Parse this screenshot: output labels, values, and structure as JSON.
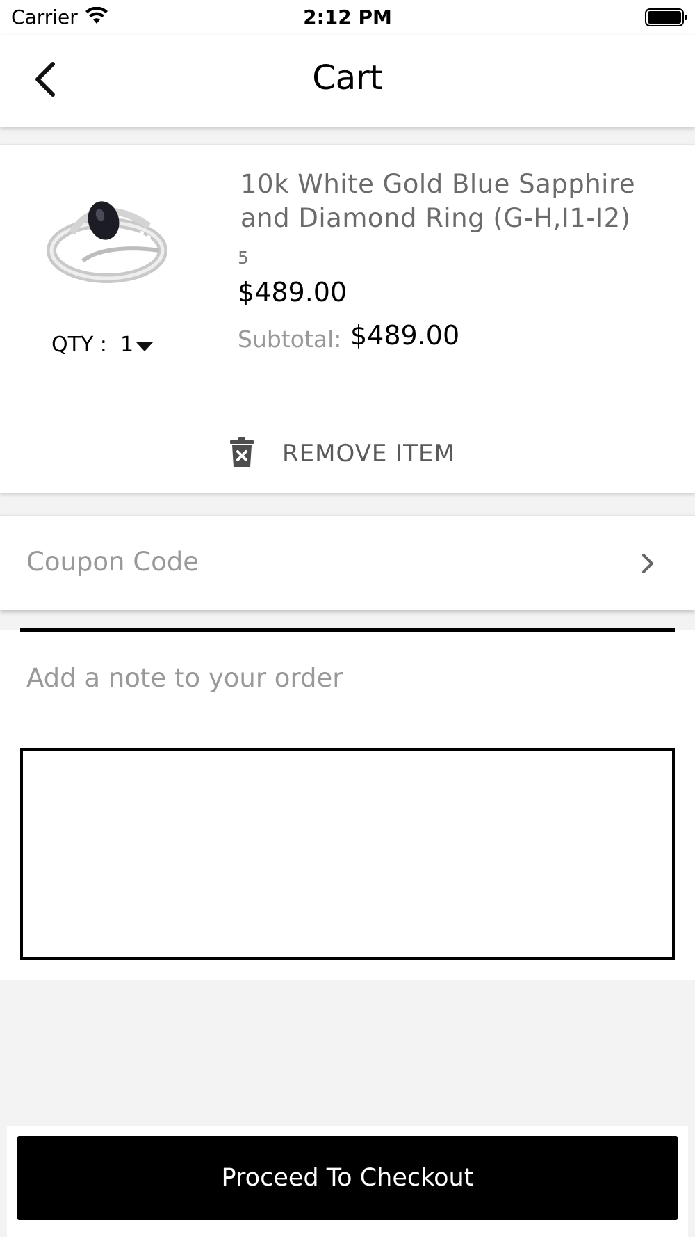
{
  "status_bar": {
    "carrier": "Carrier",
    "time": "2:12 PM"
  },
  "nav": {
    "title": "Cart",
    "back_icon": "chevron-left-icon"
  },
  "cart_item": {
    "name": "10k White Gold Blue Sapphire and Diamond Ring (G-H,I1-I2)",
    "variant": "5",
    "price": "$489.00",
    "subtotal_label": "Subtotal:",
    "subtotal_value": "$489.00",
    "qty_label": "QTY :  1",
    "remove_label": "REMOVE ITEM",
    "image_icon": "ring-product-image",
    "remove_icon": "trash-icon"
  },
  "coupon": {
    "label": "Coupon Code",
    "icon": "chevron-right-icon"
  },
  "note": {
    "label": "Add a note to your order",
    "value": ""
  },
  "checkout": {
    "label": "Proceed To Checkout"
  },
  "colors": {
    "background": "#f3f3f3",
    "primary_button": "#000000",
    "muted_text": "#999999"
  }
}
